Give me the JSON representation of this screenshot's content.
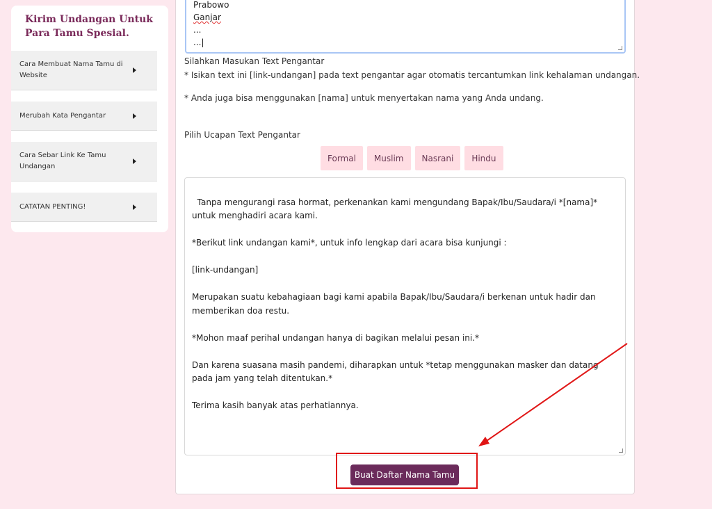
{
  "sidebar": {
    "title": "Kirim Undangan Untuk Para Tamu Spesial.",
    "items": [
      {
        "label": "Cara Membuat Nama Tamu di Website"
      },
      {
        "label": "Merubah Kata Pengantar"
      },
      {
        "label": "Cara Sebar Link Ke Tamu Undangan"
      },
      {
        "label": "CATATAN PENTING!"
      }
    ]
  },
  "guest_list": {
    "lines": [
      "Prabowo",
      "Ganjar",
      "...",
      "..."
    ]
  },
  "intro": {
    "label": "Silahkan Masukan Text Pengantar",
    "note1": "* Isikan text ini [link-undangan] pada text pengantar agar otomatis tercantumkan link kehalaman undangan.",
    "note2": "* Anda juga bisa menggunakan [nama] untuk menyertakan nama yang Anda undang."
  },
  "template_picker": {
    "label": "Pilih Ucapan Text Pengantar",
    "options": [
      "Formal",
      "Muslim",
      "Nasrani",
      "Hindu"
    ]
  },
  "message": {
    "value": "Tanpa mengurangi rasa hormat, perkenankan kami mengundang Bapak/Ibu/Saudara/i *[nama]* untuk menghadiri acara kami.\n\n*Berikut link undangan kami*, untuk info lengkap dari acara bisa kunjungi :\n\n[link-undangan]\n\nMerupakan suatu kebahagiaan bagi kami apabila Bapak/Ibu/Saudara/i berkenan untuk hadir dan memberikan doa restu.\n\n*Mohon maaf perihal undangan hanya di bagikan melalui pesan ini.*\n\nDan karena suasana masih pandemi, diharapkan untuk *tetap menggunakan masker dan datang pada jam yang telah ditentukan.*\n\nTerima kasih banyak atas perhatiannya."
  },
  "actions": {
    "submit_label": "Buat Daftar Nama Tamu"
  },
  "colors": {
    "background": "#fde8ee",
    "accent": "#6b2b5b",
    "annotation": "#e01515"
  }
}
